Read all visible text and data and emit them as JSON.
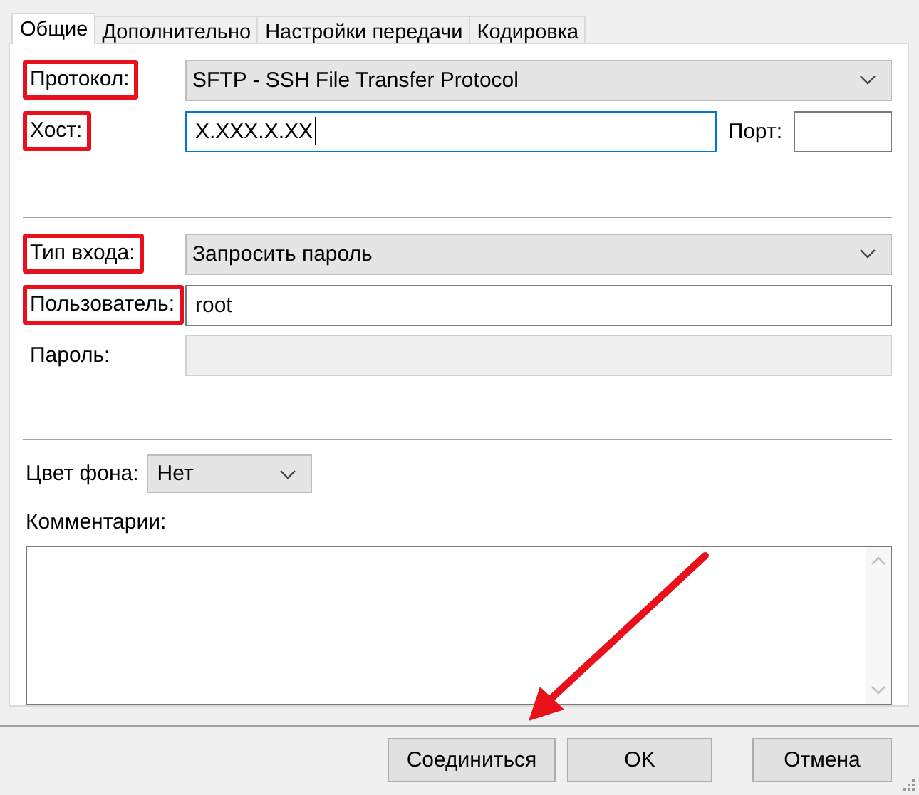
{
  "tabs": [
    {
      "label": "Общие",
      "selected": true
    },
    {
      "label": "Дополнительно",
      "selected": false
    },
    {
      "label": "Настройки передачи",
      "selected": false
    },
    {
      "label": "Кодировка",
      "selected": false
    }
  ],
  "protocol": {
    "label": "Протокол:",
    "value": "SFTP - SSH File Transfer Protocol",
    "highlighted": true
  },
  "host": {
    "label": "Хост:",
    "value": "X.XXX.X.XX",
    "highlighted": true,
    "focused": true
  },
  "port": {
    "label": "Порт:"
  },
  "login_type": {
    "label": "Тип входа:",
    "value": "Запросить пароль",
    "highlighted": true
  },
  "user": {
    "label": "Пользователь:",
    "value": "root",
    "highlighted": true
  },
  "password": {
    "label": "Пароль:",
    "disabled": true,
    "highlighted": false
  },
  "background_color": {
    "label": "Цвет фона:",
    "value": "Нет"
  },
  "comments": {
    "label": "Комментарии:"
  },
  "buttons": [
    {
      "label": "Соединиться"
    },
    {
      "label": "OK"
    },
    {
      "label": "Отмена"
    }
  ]
}
